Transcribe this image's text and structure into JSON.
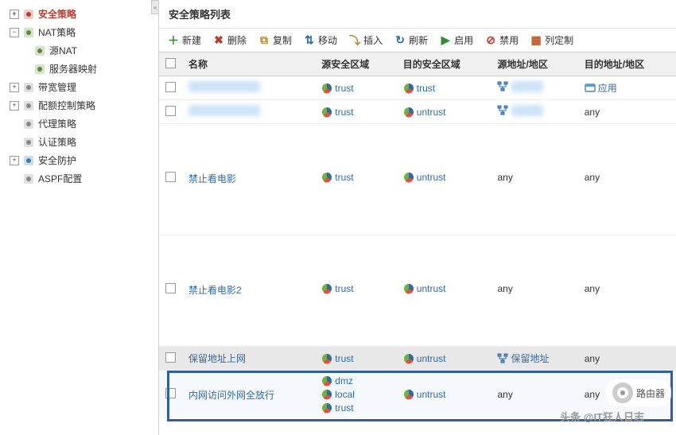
{
  "sidebar": {
    "items": [
      {
        "label": "安全策略",
        "icon": "shield"
      },
      {
        "label": "NAT策略",
        "icon": "nat",
        "children": [
          {
            "label": "源NAT",
            "icon": "natc"
          },
          {
            "label": "服务器映射",
            "icon": "natc"
          }
        ]
      },
      {
        "label": "带宽管理",
        "icon": "bw"
      },
      {
        "label": "配额控制策略",
        "icon": "quota"
      },
      {
        "label": "代理策略",
        "icon": "proxy"
      },
      {
        "label": "认证策略",
        "icon": "auth"
      },
      {
        "label": "安全防护",
        "icon": "guard"
      },
      {
        "label": "ASPF配置",
        "icon": "aspf"
      }
    ]
  },
  "main_title": "安全策略列表",
  "toolbar": [
    {
      "label": "新建",
      "icon": "plus"
    },
    {
      "label": "删除",
      "icon": "delete"
    },
    {
      "label": "复制",
      "icon": "copy"
    },
    {
      "label": "移动",
      "icon": "move"
    },
    {
      "label": "插入",
      "icon": "insert"
    },
    {
      "label": "刷新",
      "icon": "refresh"
    },
    {
      "label": "启用",
      "icon": "enable"
    },
    {
      "label": "禁用",
      "icon": "disable"
    },
    {
      "label": "列定制",
      "icon": "cols"
    }
  ],
  "columns": {
    "name": "名称",
    "src_zone": "源安全区域",
    "dst_zone": "目的安全区域",
    "src_addr": "源地址/地区",
    "dst_addr": "目的地址/地区"
  },
  "rows": [
    {
      "name_blur": true,
      "src": [
        "trust"
      ],
      "dst": [
        "trust"
      ],
      "src_addr_blur": true,
      "src_addr_net": true,
      "dst_addr": "应用",
      "dst_addr_link": true,
      "dst_addr_icon": "app"
    },
    {
      "name_blur": true,
      "src": [
        "trust"
      ],
      "dst": [
        "untrust"
      ],
      "src_addr_blur": true,
      "src_addr_net": true,
      "dst_addr": "any"
    },
    {
      "name": "禁止看电影",
      "src": [
        "trust"
      ],
      "dst": [
        "untrust"
      ],
      "src_addr": "any",
      "dst_addr": "any",
      "tall": true
    },
    {
      "name": "禁止看电影2",
      "src": [
        "trust"
      ],
      "dst": [
        "untrust"
      ],
      "src_addr": "any",
      "dst_addr": "any",
      "tall": true
    },
    {
      "name": "保留地址上网",
      "src": [
        "trust"
      ],
      "dst": [
        "untrust"
      ],
      "src_addr": "保留地址",
      "src_addr_link": true,
      "src_addr_net": true,
      "dst_addr": "any",
      "selected": true
    },
    {
      "name": "内网访问外网全放行",
      "src": [
        "dmz",
        "local",
        "trust"
      ],
      "dst": [
        "untrust"
      ],
      "src_addr": "any",
      "dst_addr": "any",
      "highlighted": true
    }
  ],
  "zone_text": {
    "trust": "trust",
    "untrust": "untrust",
    "dmz": "dmz",
    "local": "local"
  },
  "overlay": {
    "badge": "路由器",
    "footer": "头条 @IT狂人日志"
  }
}
